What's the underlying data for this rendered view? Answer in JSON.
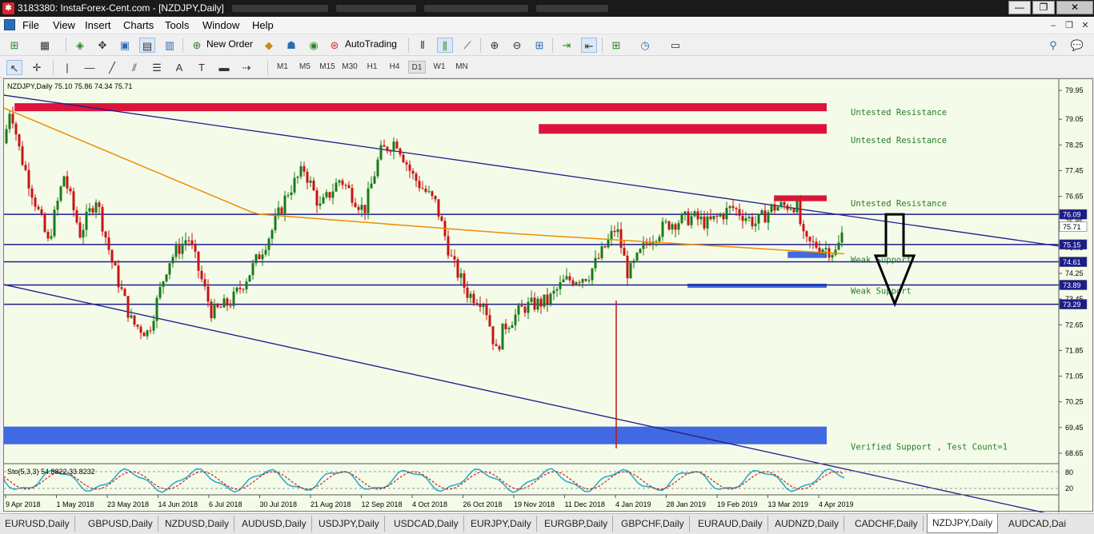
{
  "window": {
    "title": "3183380: InstaForex-Cent.com - [NZDJPY,Daily]",
    "min": "—",
    "restore": "❐",
    "close": "✕"
  },
  "menu": [
    "File",
    "View",
    "Insert",
    "Charts",
    "Tools",
    "Window",
    "Help"
  ],
  "toolbar": {
    "new_order": "New Order",
    "autotrading": "AutoTrading"
  },
  "timeframes": [
    "M1",
    "M5",
    "M15",
    "M30",
    "H1",
    "H4",
    "D1",
    "W1",
    "MN"
  ],
  "active_timeframe": "D1",
  "chart_data": {
    "type": "candlestick",
    "symbol_header": "NZDJPY,Daily  75.10 75.86 74.34 75.71",
    "y_ticks": [
      "79.95",
      "79.05",
      "78.25",
      "77.45",
      "76.65",
      "75.85",
      "75.05",
      "74.25",
      "73.45",
      "72.65",
      "71.85",
      "71.05",
      "70.25",
      "69.45",
      "68.65"
    ],
    "ylim": [
      68.4,
      80.2
    ],
    "x_ticks": [
      "9 Apr 2018",
      "1 May 2018",
      "23 May 2018",
      "14 Jun 2018",
      "6 Jul 2018",
      "30 Jul 2018",
      "21 Aug 2018",
      "12 Sep 2018",
      "4 Oct 2018",
      "26 Oct 2018",
      "19 Nov 2018",
      "11 Dec 2018",
      "4 Jan 2019",
      "28 Jan 2019",
      "19 Feb 2019",
      "13 Mar 2019",
      "4 Apr 2019"
    ],
    "price_tags": [
      {
        "label": "76.09",
        "value": 76.09
      },
      {
        "label": "75.71",
        "value": 75.71
      },
      {
        "label": "75.15",
        "value": 75.15
      },
      {
        "label": "74.61",
        "value": 74.61
      },
      {
        "label": "73.89",
        "value": 73.89
      },
      {
        "label": "73.29",
        "value": 73.29
      }
    ],
    "horizontal_lines": [
      76.09,
      75.15,
      74.61,
      73.89,
      73.29
    ],
    "zones": [
      {
        "label": "Untested Resistance",
        "color": "#dc143c",
        "from": 79.3,
        "to": 79.55,
        "start": 0.01,
        "end": 0.78
      },
      {
        "label": "Untested Resistance",
        "color": "#dc143c",
        "from": 78.6,
        "to": 78.9,
        "start": 0.507,
        "end": 0.78
      },
      {
        "label": "Untested Resistance",
        "color": "#dc143c",
        "from": 76.5,
        "to": 76.68,
        "start": 0.73,
        "end": 0.78
      },
      {
        "label": "Weak Support",
        "color": "#4169e1",
        "from": 74.73,
        "to": 74.93,
        "start": 0.743,
        "end": 0.78
      },
      {
        "label": "Weak Support",
        "color": "#4169e1",
        "from": 73.8,
        "to": 73.93,
        "start": 0.648,
        "end": 0.78
      },
      {
        "label": "Verified Support , Test Count=1",
        "color": "#4169e1",
        "from": 68.93,
        "to": 69.48,
        "start": 0,
        "end": 0.78
      }
    ],
    "trendlines": [
      {
        "from": [
          0.0,
          79.8
        ],
        "to": [
          1.0,
          75.1
        ]
      },
      {
        "from": [
          0.0,
          73.9
        ],
        "to": [
          1.0,
          66.7
        ]
      }
    ],
    "arrow_note": "down arrow",
    "oscillator": {
      "label": "Sto(5,3,3) 54.8822 33.8232",
      "levels": [
        "80",
        "20"
      ]
    }
  },
  "tabs": [
    "EURUSD,Daily",
    "GBPUSD,Daily",
    "NZDUSD,Daily",
    "AUDUSD,Daily",
    "USDJPY,Daily",
    "USDCAD,Daily",
    "EURJPY,Daily",
    "EURGBP,Daily",
    "GBPCHF,Daily",
    "EURAUD,Daily",
    "AUDNZD,Daily",
    "CADCHF,Daily",
    "NZDJPY,Daily",
    "AUDCAD,Dai"
  ],
  "active_tab": "NZDJPY,Daily"
}
